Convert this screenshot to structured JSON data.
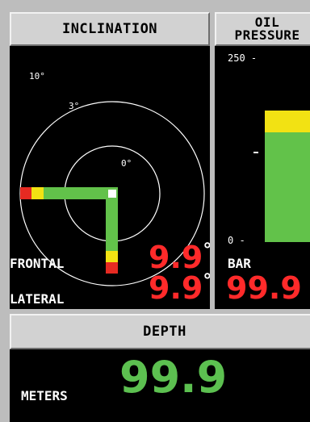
{
  "inclination": {
    "title": "INCLINATION",
    "rings": {
      "outer_label": "10°",
      "inner_label": "3°",
      "center_label": "0°"
    },
    "frontal_label": "FRONTAL",
    "frontal_value": "9.9",
    "lateral_label": "LATERAL",
    "lateral_value": "9.9",
    "degree_symbol": "°"
  },
  "oil_pressure": {
    "title_line1": "OIL",
    "title_line2": "PRESSURE",
    "scale_max_label": "250 -",
    "scale_min_label": "0 -",
    "unit_label": "BAR",
    "value": "99.9",
    "level_fraction": 0.6
  },
  "depth": {
    "title": "DEPTH",
    "unit_label": "METERS",
    "value": "99.9"
  },
  "colors": {
    "background": "#bdbdbd",
    "panel": "#000000",
    "warning_red": "#ff2a2a",
    "value_green": "#5cc050",
    "bar_green": "#62c24a",
    "bar_yellow": "#f2e213",
    "bar_red": "#e62a22"
  }
}
